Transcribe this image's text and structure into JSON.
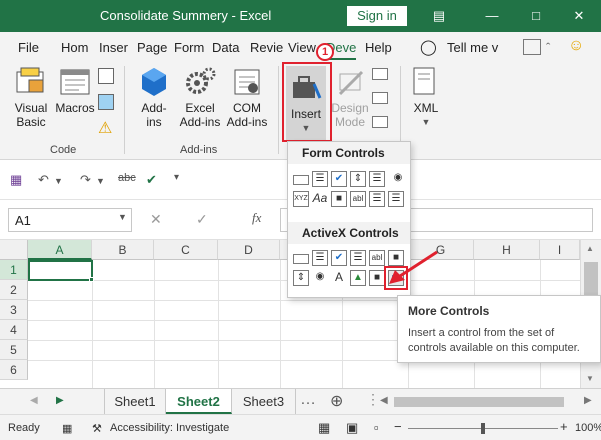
{
  "window": {
    "title": "Consolidate Summery  -  Excel",
    "sign_in": "Sign in",
    "accent": "#217346"
  },
  "menu": {
    "tabs": [
      "File",
      "Hom",
      "Inser",
      "Page",
      "Form",
      "Data",
      "Revie",
      "View",
      "Deve",
      "Help"
    ],
    "tell_me": "Tell me v"
  },
  "ribbon": {
    "code_group": {
      "label": "Code",
      "visual_basic": "Visual Basic",
      "macros": "Macros"
    },
    "addins_group": {
      "label": "Add-ins",
      "addins": "Add-ins",
      "excel_addins": "Excel Add-ins",
      "com_addins": "COM Add-ins"
    },
    "controls_group": {
      "insert": "Insert",
      "design_mode": "Design Mode"
    },
    "xml_group": {
      "xml": "XML"
    }
  },
  "step_badge": "1",
  "formula_bar": {
    "name_box": "A1",
    "fx": "fx"
  },
  "grid": {
    "columns": [
      "A",
      "B",
      "C",
      "D",
      "E",
      "F",
      "G",
      "H",
      "I"
    ],
    "rows": [
      "1",
      "2",
      "3",
      "4",
      "5",
      "6"
    ],
    "selected_cell": "A1"
  },
  "insert_dropdown": {
    "form_controls_label": "Form Controls",
    "activex_controls_label": "ActiveX Controls"
  },
  "tooltip": {
    "title": "More Controls",
    "body": "Insert a control from the set of controls available on this computer."
  },
  "sheets": {
    "tabs": [
      "Sheet1",
      "Sheet2",
      "Sheet3"
    ],
    "active": "Sheet2"
  },
  "status_bar": {
    "ready": "Ready",
    "accessibility": "Accessibility: Investigate",
    "zoom": "100%"
  }
}
